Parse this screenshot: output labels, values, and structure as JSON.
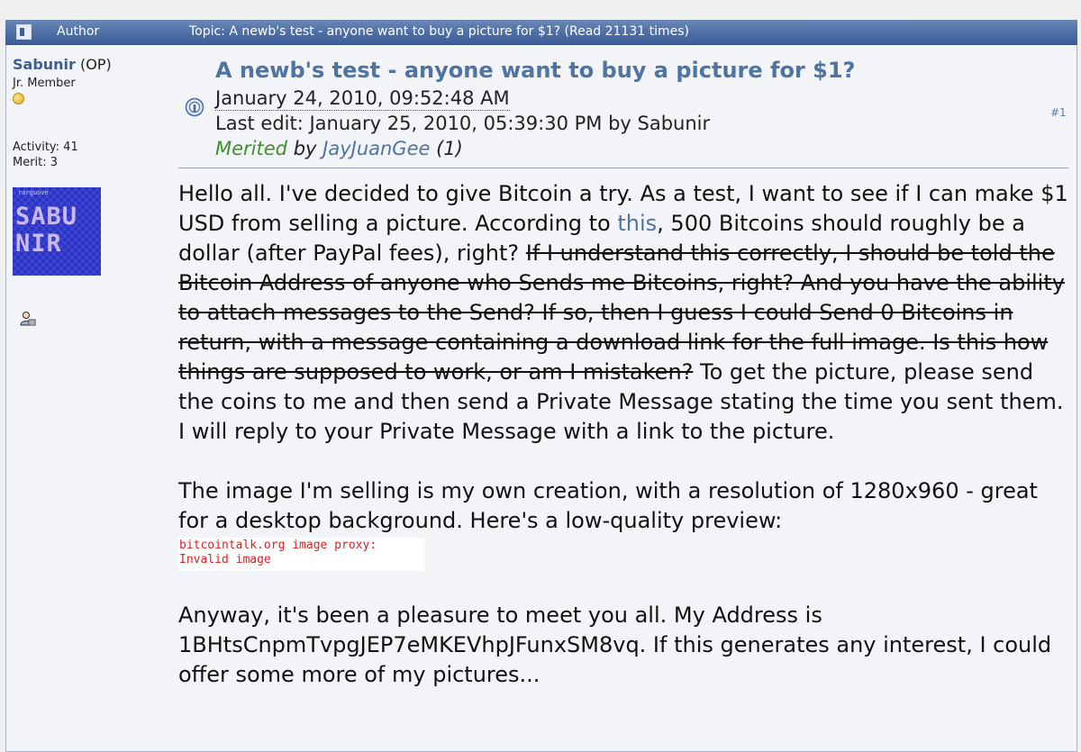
{
  "header": {
    "author_label": "Author",
    "topic_label": "Topic: A newb's test - anyone want to buy a picture for $1?  (Read 21131 times)"
  },
  "user": {
    "name": "Sabunir",
    "op_tag": "(OP)",
    "rank": "Jr. Member",
    "activity": "Activity: 41",
    "merit": "Merit: 3",
    "avatar_small_text": "rarguove",
    "avatar_text": "SABU NIR"
  },
  "post": {
    "title": "A newb's test - anyone want to buy a picture for $1?",
    "date": "January 24, 2010, 09:52:48 AM",
    "last_edit": "Last edit: January 25, 2010, 05:39:30 PM by Sabunir",
    "merited_word": "Merited",
    "merited_by": "by",
    "merited_user": "JayJuanGee",
    "merited_count": "(1)",
    "post_number": "#1",
    "body": {
      "p1_a": "Hello all. I've decided to give Bitcoin a try. As a test, I want to see if I can make $1 USD from selling a picture. According to ",
      "p1_link": "this",
      "p1_b": ", 500 Bitcoins should roughly be a dollar (after PayPal fees), right? ",
      "p1_strike": "If I understand this correctly, I should be told the Bitcoin Address of anyone who Sends me Bitcoins, right? And you have the ability to attach messages to the Send? If so, then I guess I could Send 0 Bitcoins in return, with a message containing a download link for the full image. Is this how things are supposed to work, or am I mistaken?",
      "p1_c": " To get the picture, please send the coins to me and then send a Private Message stating the time you sent them. I will reply to your Private Message with a link to the picture.",
      "p2": "The image I'm selling is my own creation, with a resolution of 1280x960 - great for a desktop background. Here's a low-quality preview:",
      "proxy_line1": "bitcointalk.org image proxy:",
      "proxy_line2": "Invalid image",
      "p3": "Anyway, it's been a pleasure to meet you all. My Address is 1BHtsCnpmTvpgJEP7eMKEVhpJFunxSM8vq. If this generates any interest, I could offer some more of my pictures..."
    }
  },
  "colors": {
    "header_bar": "#4a6ca3",
    "link": "#4f73a3",
    "merited_green": "#3e8f27",
    "proxy_red": "#dd2222"
  }
}
